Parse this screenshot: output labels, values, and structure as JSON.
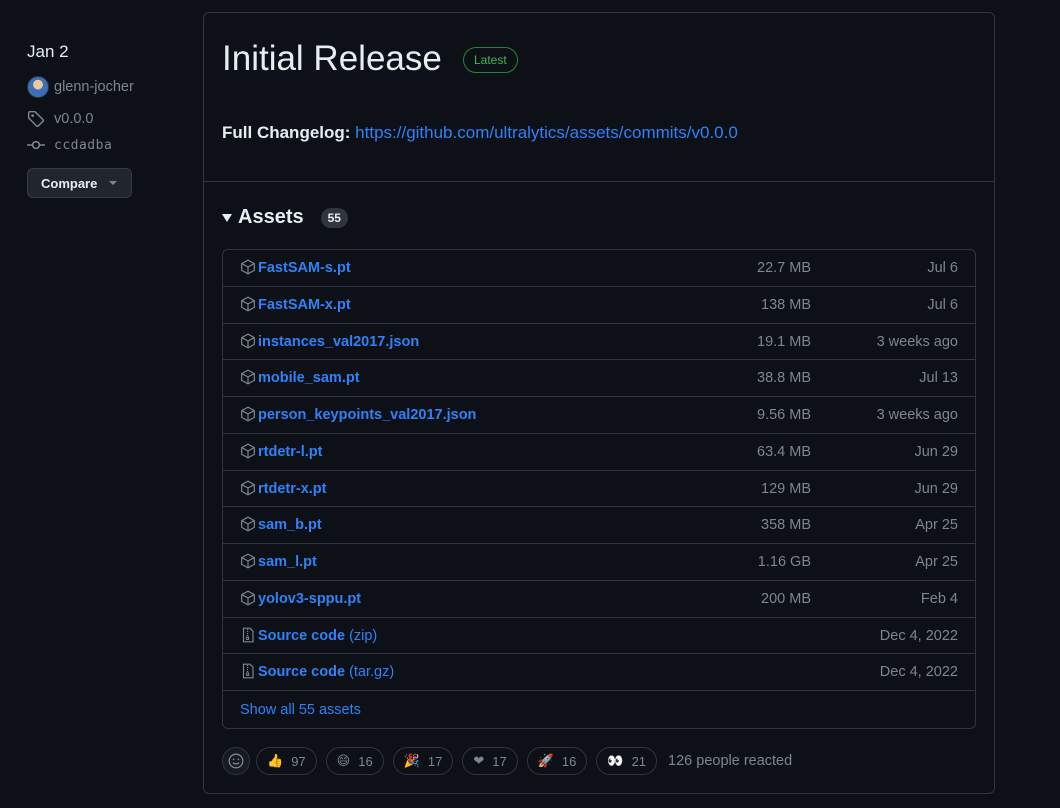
{
  "meta": {
    "date": "Jan 2",
    "author": "glenn-jocher",
    "tag": "v0.0.0",
    "commit": "ccdadba",
    "compare_label": "Compare"
  },
  "release": {
    "title": "Initial Release",
    "badge": "Latest",
    "changelog_label": "Full Changelog:",
    "changelog_link": "https://github.com/ultralytics/assets/commits/v0.0.0"
  },
  "assets": {
    "title": "Assets",
    "count": "55",
    "items": [
      {
        "name": "FastSAM-s.pt",
        "size": "22.7 MB",
        "date": "Jul 6"
      },
      {
        "name": "FastSAM-x.pt",
        "size": "138 MB",
        "date": "Jul 6"
      },
      {
        "name": "instances_val2017.json",
        "size": "19.1 MB",
        "date": "3 weeks ago"
      },
      {
        "name": "mobile_sam.pt",
        "size": "38.8 MB",
        "date": "Jul 13"
      },
      {
        "name": "person_keypoints_val2017.json",
        "size": "9.56 MB",
        "date": "3 weeks ago"
      },
      {
        "name": "rtdetr-l.pt",
        "size": "63.4 MB",
        "date": "Jun 29"
      },
      {
        "name": "rtdetr-x.pt",
        "size": "129 MB",
        "date": "Jun 29"
      },
      {
        "name": "sam_b.pt",
        "size": "358 MB",
        "date": "Apr 25"
      },
      {
        "name": "sam_l.pt",
        "size": "1.16 GB",
        "date": "Apr 25"
      },
      {
        "name": "yolov3-sppu.pt",
        "size": "200 MB",
        "date": "Feb 4"
      }
    ],
    "source": [
      {
        "name": "Source code",
        "format": "(zip)",
        "date": "Dec 4, 2022"
      },
      {
        "name": "Source code",
        "format": "(tar.gz)",
        "date": "Dec 4, 2022"
      }
    ],
    "show_all": "Show all 55 assets"
  },
  "reactions": {
    "items": [
      {
        "emoji": "👍",
        "icon": "thumbs-up-icon",
        "count": "97"
      },
      {
        "emoji": "😄",
        "icon": "laugh-icon",
        "count": "16"
      },
      {
        "emoji": "🎉",
        "icon": "hooray-icon",
        "count": "17"
      },
      {
        "emoji": "❤",
        "icon": "heart-icon",
        "count": "17"
      },
      {
        "emoji": "🚀",
        "icon": "rocket-icon",
        "count": "16"
      },
      {
        "emoji": "👀",
        "icon": "eyes-icon",
        "count": "21"
      }
    ],
    "summary": "126 people reacted"
  }
}
